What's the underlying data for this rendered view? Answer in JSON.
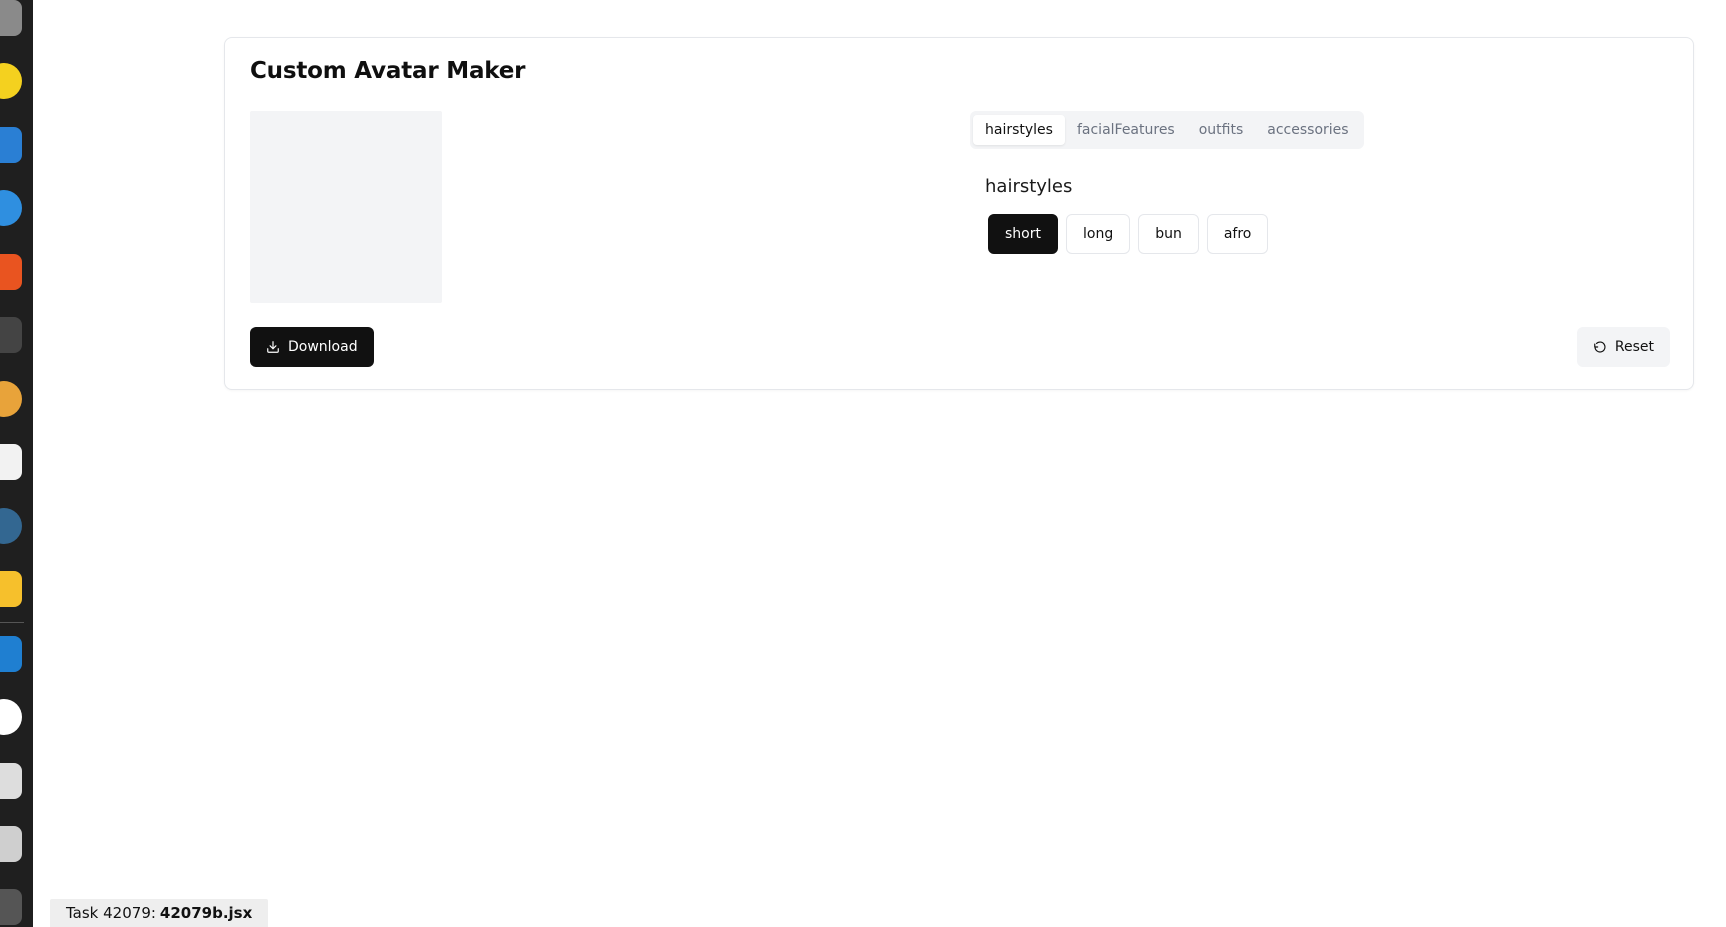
{
  "app": {
    "title": "Custom Avatar Maker"
  },
  "tabs": [
    {
      "label": "hairstyles",
      "active": true
    },
    {
      "label": "facialFeatures",
      "active": false
    },
    {
      "label": "outfits",
      "active": false
    },
    {
      "label": "accessories",
      "active": false
    }
  ],
  "section": {
    "title": "hairstyles",
    "options": [
      {
        "label": "short",
        "selected": true
      },
      {
        "label": "long",
        "selected": false
      },
      {
        "label": "bun",
        "selected": false
      },
      {
        "label": "afro",
        "selected": false
      }
    ]
  },
  "actions": {
    "download_label": "Download",
    "download_icon": "download-icon",
    "reset_label": "Reset",
    "reset_icon": "undo-icon"
  },
  "task": {
    "prefix": "Task 42079:",
    "file": "42079b.jsx"
  },
  "colors": {
    "primary": "#111111",
    "muted_bg": "#f3f4f6",
    "border": "#e5e7eb"
  }
}
